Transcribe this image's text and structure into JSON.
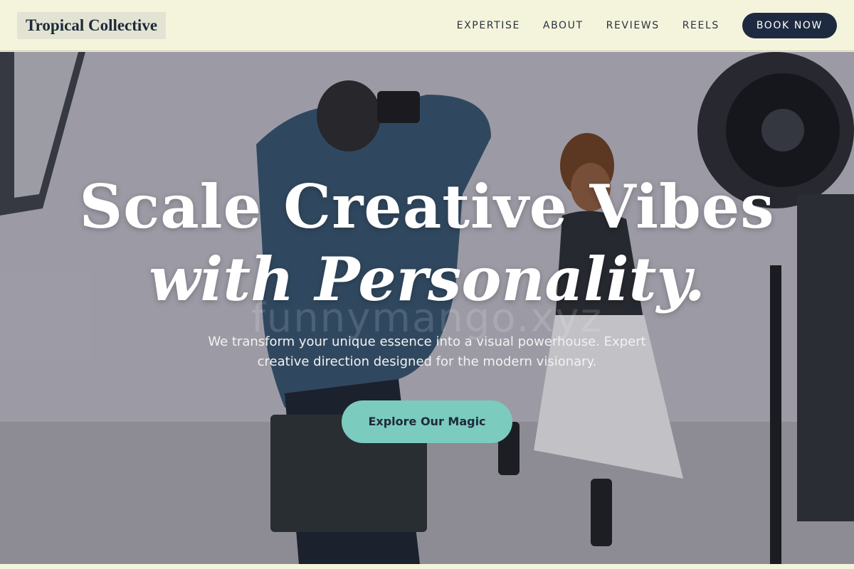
{
  "header": {
    "brand": "Tropical Collective",
    "nav": [
      "EXPERTISE",
      "ABOUT",
      "REVIEWS",
      "REELS"
    ],
    "cta_label": "BOOK NOW"
  },
  "hero": {
    "headline_line1": "Scale Creative Vibes",
    "headline_line2": "with Personality.",
    "watermark": "funnymango.xyz",
    "subtext": "We transform your unique essence into a visual powerhouse. Expert creative direction designed for the modern visionary.",
    "cta_label": "Explore Our Magic",
    "image_icon": "photo-studio-image"
  },
  "colors": {
    "background": "#f4f4dc",
    "nav_button": "#1e2a40",
    "cta": "#7ccbbf",
    "text_dark": "#1e2a3a"
  }
}
